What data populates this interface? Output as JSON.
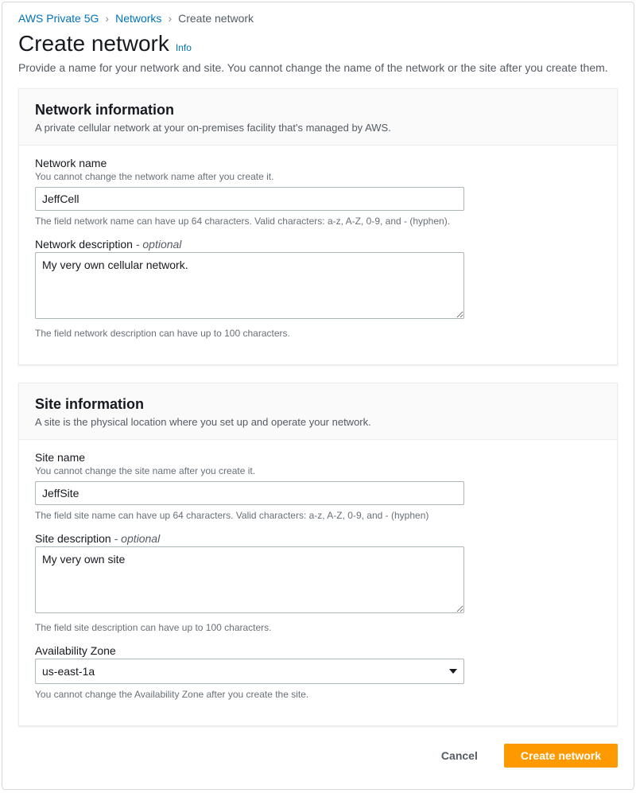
{
  "breadcrumb": {
    "items": [
      {
        "label": "AWS Private 5G",
        "link": true
      },
      {
        "label": "Networks",
        "link": true
      },
      {
        "label": "Create network",
        "link": false
      }
    ]
  },
  "header": {
    "title": "Create network",
    "info": "Info",
    "description": "Provide a name for your network and site. You cannot change the name of the network or the site after you create them."
  },
  "network_panel": {
    "title": "Network information",
    "subtitle": "A private cellular network at your on-premises facility that's managed by AWS.",
    "name": {
      "label": "Network name",
      "hint_top": "You cannot change the network name after you create it.",
      "value": "JeffCell",
      "hint_bottom": "The field network name can have up 64 characters. Valid characters: a-z, A-Z, 0-9, and - (hyphen)."
    },
    "desc": {
      "label": "Network description",
      "optional": " - optional",
      "value": "My very own cellular network.",
      "hint_bottom": "The field network description can have up to 100 characters."
    }
  },
  "site_panel": {
    "title": "Site information",
    "subtitle": "A site is the physical location where you set up and operate your network.",
    "name": {
      "label": "Site name",
      "hint_top": "You cannot change the site name after you create it.",
      "value": "JeffSite",
      "hint_bottom": "The field site name can have up 64 characters. Valid characters: a-z, A-Z, 0-9, and - (hyphen)"
    },
    "desc": {
      "label": "Site description",
      "optional": " - optional",
      "value": "My very own site",
      "hint_bottom": "The field site description can have up to 100 characters."
    },
    "az": {
      "label": "Availability Zone",
      "value": "us-east-1a",
      "hint_bottom": "You cannot change the Availability Zone after you create the site."
    }
  },
  "actions": {
    "cancel": "Cancel",
    "submit": "Create network"
  }
}
